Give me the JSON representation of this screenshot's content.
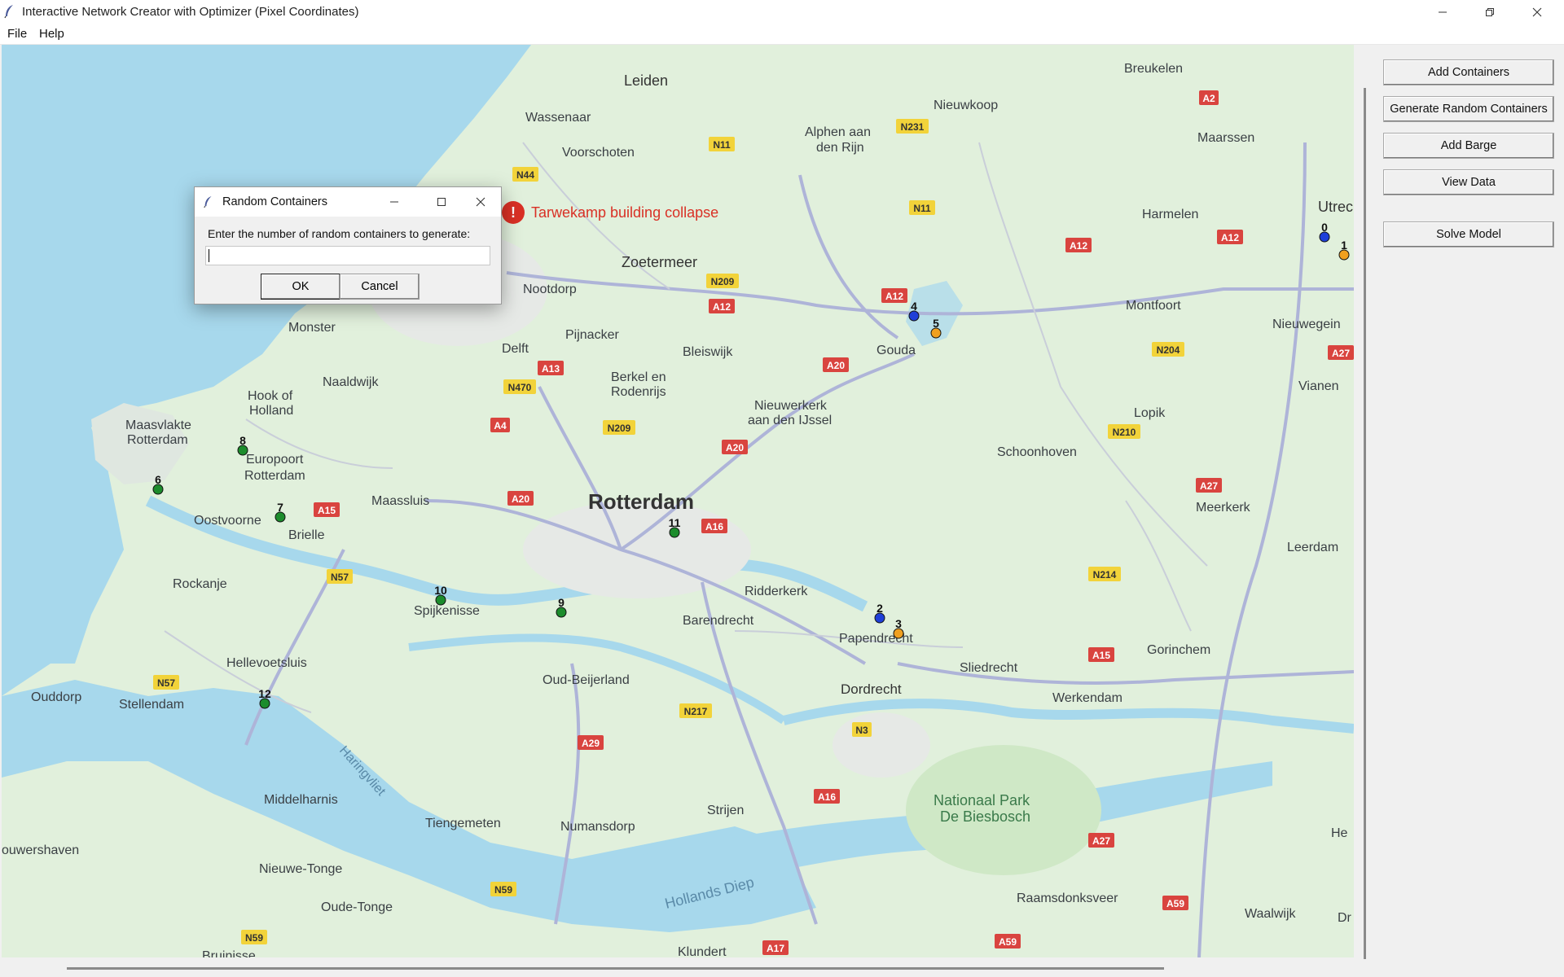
{
  "window": {
    "title": "Interactive Network Creator with Optimizer (Pixel Coordinates)",
    "controls": [
      "minimize-icon",
      "restore-icon",
      "close-icon"
    ]
  },
  "menu": [
    "File",
    "Help"
  ],
  "sidebar": {
    "buttons": [
      "Add Containers",
      "Generate Random Containers",
      "Add Barge",
      "View Data",
      "Solve Model"
    ]
  },
  "map": {
    "incident": "Tarwekamp building collapse",
    "places": {
      "leiden": "Leiden",
      "wassenaar": "Wassenaar",
      "voorschoten": "Voorschoten",
      "alphen1": "Alphen aan",
      "alphen2": "den Rijn",
      "nieuwkoop": "Nieuwkoop",
      "breukelen": "Breukelen",
      "maarssen": "Maarssen",
      "harmelen": "Harmelen",
      "utrecht": "Utrec",
      "zoetermeer": "Zoetermeer",
      "nootdorp": "Nootdorp",
      "pijnacker": "Pijnacker",
      "bleiswijk": "Bleiswijk",
      "delft": "Delft",
      "monster": "Monster",
      "naaldwijk": "Naaldwijk",
      "hook1": "Hook of",
      "hook2": "Holland",
      "maasvlakte1": "Maasvlakte",
      "maasvlakte2": "Rotterdam",
      "europoort1": "Europoort",
      "europoort2": "Rotterdam",
      "berkel1": "Berkel en",
      "berkel2": "Rodenrijs",
      "nieuwerkerk1": "Nieuwerkerk",
      "nieuwerkerk2": "aan den IJssel",
      "gouda": "Gouda",
      "montfoort": "Montfoort",
      "nieuwegein": "Nieuwegein",
      "vianen": "Vianen",
      "lopik": "Lopik",
      "schoonhoven": "Schoonhoven",
      "meerkerk": "Meerkerk",
      "leerdam": "Leerdam",
      "rotterdam": "Rotterdam",
      "maassluis": "Maassluis",
      "oostvoorne": "Oostvoorne",
      "brielle": "Brielle",
      "rockanje": "Rockanje",
      "spijkenisse": "Spijkenisse",
      "ridderkerk": "Ridderkerk",
      "barendrecht": "Barendrecht",
      "papendrecht": "Papendrecht",
      "sliedrecht": "Sliedrecht",
      "gorinchem": "Gorinchem",
      "dordrecht": "Dordrecht",
      "werkendam": "Werkendam",
      "hellevoetsluis": "Hellevoetsluis",
      "ouddorp": "Ouddorp",
      "stellendam": "Stellendam",
      "oudbeijerland": "Oud-Beijerland",
      "haringvliet": "Haringvliet",
      "middelharnis": "Middelharnis",
      "tiengemeten": "Tiengemeten",
      "numansdorp": "Numansdorp",
      "strijen": "Strijen",
      "biesbosch1": "Nationaal Park",
      "biesbosch2": "De Biesbosch",
      "ouwershaven": "ouwershaven",
      "nieuwetonge": "Nieuwe-Tonge",
      "oudetonge": "Oude-Tonge",
      "hollandsdiep": "Hollands Diep",
      "raamsdonksveer": "Raamsdonksveer",
      "waalwijk": "Waalwijk",
      "klundert": "Klundert",
      "bruinisse": "Bruinisse",
      "he": "He",
      "dr": "Dr"
    },
    "roads": {
      "a2": "A2",
      "n231": "N231",
      "n11a": "N11",
      "n44": "N44",
      "n11b": "N11",
      "a12a": "A12",
      "a12b": "A12",
      "n209a": "N209",
      "a12c": "A12",
      "a12d": "A12",
      "a27a": "A27",
      "n204": "N204",
      "a20a": "A20",
      "a13": "A13",
      "n470": "N470",
      "a4": "A4",
      "n209b": "N209",
      "a20b": "A20",
      "n210": "N210",
      "a27b": "A27",
      "a20c": "A20",
      "a16a": "A16",
      "a15a": "A15",
      "n57a": "N57",
      "n214": "N214",
      "a15b": "A15",
      "n57b": "N57",
      "n217": "N217",
      "a29": "A29",
      "n3": "N3",
      "a16b": "A16",
      "a27c": "A27",
      "n59a": "N59",
      "a59a": "A59",
      "n59b": "N59",
      "a17": "A17",
      "a59b": "A59"
    },
    "markers": [
      {
        "id": "0",
        "color": "#1f3fd8"
      },
      {
        "id": "1",
        "color": "#f0a020"
      },
      {
        "id": "2",
        "color": "#1f3fd8"
      },
      {
        "id": "3",
        "color": "#f0a020"
      },
      {
        "id": "4",
        "color": "#1f3fd8"
      },
      {
        "id": "5",
        "color": "#f0a020"
      },
      {
        "id": "6",
        "color": "#1c8c2c"
      },
      {
        "id": "7",
        "color": "#1c8c2c"
      },
      {
        "id": "8",
        "color": "#1c8c2c"
      },
      {
        "id": "9",
        "color": "#1c8c2c"
      },
      {
        "id": "10",
        "color": "#1c8c2c"
      },
      {
        "id": "11",
        "color": "#1c8c2c"
      },
      {
        "id": "12",
        "color": "#1c8c2c"
      }
    ]
  },
  "dialog": {
    "title": "Random Containers",
    "prompt": "Enter the number of random containers to generate:",
    "input_value": "",
    "ok_label": "OK",
    "cancel_label": "Cancel",
    "controls": [
      "minimize-icon",
      "maximize-icon",
      "close-icon"
    ]
  },
  "colors": {
    "water": "#a7d8ec",
    "land": "#e1f0dc",
    "highway_badge_red": "#d9443f",
    "road_badge_yellow": "#f2d33a",
    "incident_red": "#d93025"
  }
}
